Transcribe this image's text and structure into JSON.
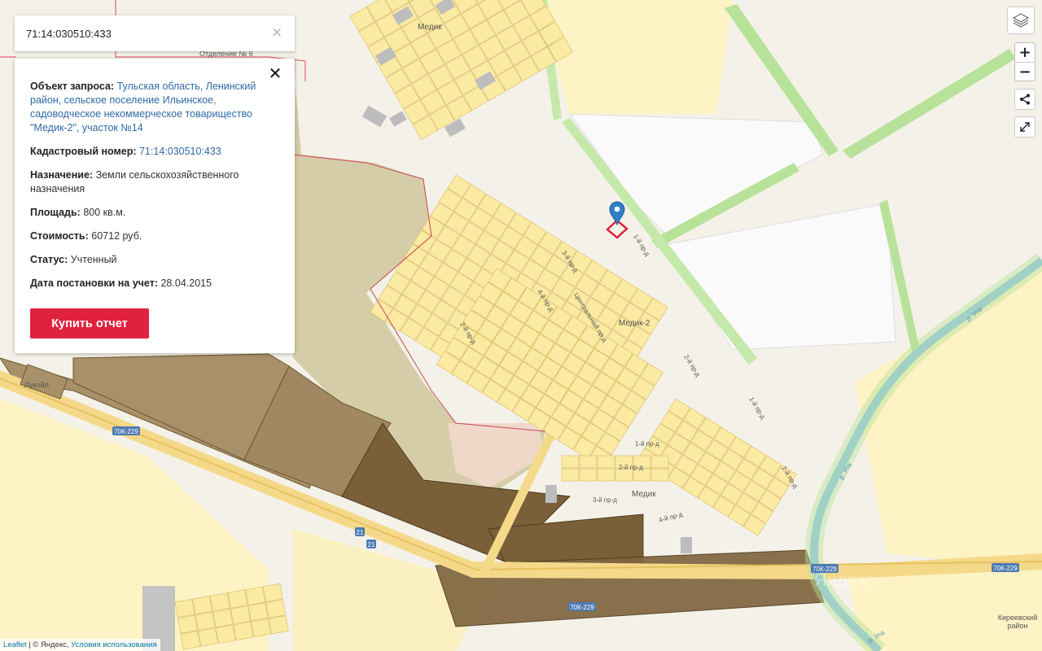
{
  "search": {
    "value": "71:14:030510:433"
  },
  "info": {
    "object_label": "Объект запроса:",
    "object_value": "Тульская область, Ленинский район, сельское поселение Ильинское, садоводческое некоммерческое товарищество \"Медик-2\", участок №14",
    "cadastral_label": "Кадастровый номер:",
    "cadastral_value": "71:14:030510:433",
    "purpose_label": "Назначение:",
    "purpose_value": "Земли сельскохозяйственного назначения",
    "area_label": "Площадь:",
    "area_value": "800 кв.м.",
    "cost_label": "Стоимость:",
    "cost_value": "60712 руб.",
    "status_label": "Статус:",
    "status_value": "Учтенный",
    "date_label": "Дата постановки на учет:",
    "date_value": "28.04.2015",
    "buy_button": "Купить отчет"
  },
  "controls": {
    "zoom_in": "+",
    "zoom_out": "−"
  },
  "attribution": {
    "leaflet": "Leaflet",
    "yandex": " | © Яндекс, ",
    "terms": "Условия использования"
  },
  "map_labels": {
    "medik_top": "Медик",
    "medik2": "Медик-2",
    "medik_bottom": "Медик",
    "lukoil": "Лукойл",
    "otdelenie": "Отделение № 6",
    "road1": "70К-229",
    "road2": "70К-229",
    "road3": "70К-229",
    "road4": "70К-229",
    "road_21a": "21",
    "road_21b": "21",
    "street_1_pr": "1-й пр-д",
    "street_2_pr": "2-й пр-д",
    "street_3_pr": "3-й пр-д",
    "street_4_pr": "4-й пр-д",
    "street_central": "Центральный пр-д",
    "street_1_pr_b": "1-й пр-д",
    "street_2_pr_b": "2-й пр-д",
    "street_3_pr_b": "3-й пр-д",
    "street_4_pr_b": "4-й пр-д",
    "street_1_pr_c": "1-й пр-д",
    "street_2_pr_c": "2-й пр-д",
    "street_2_pr_d": "2-й пр-д",
    "river1": "р. Упа",
    "river2": "р. Упа",
    "river3": "р. Упа",
    "kireevsky": "Киреевский",
    "raion": "район",
    "yandex_watermark": "Яндекс"
  },
  "colors": {
    "plot_fill": "#fbeaa2",
    "plot_stroke": "#d9b860",
    "field_fill": "#fdf3c4",
    "dark_parcel": "#7a6038",
    "olive_parcel": "#c8b88a",
    "green_strip": "#b8e29a",
    "water": "#8fc4e8",
    "highlight_red": "#e0223f",
    "marker_blue": "#2f80c4"
  }
}
